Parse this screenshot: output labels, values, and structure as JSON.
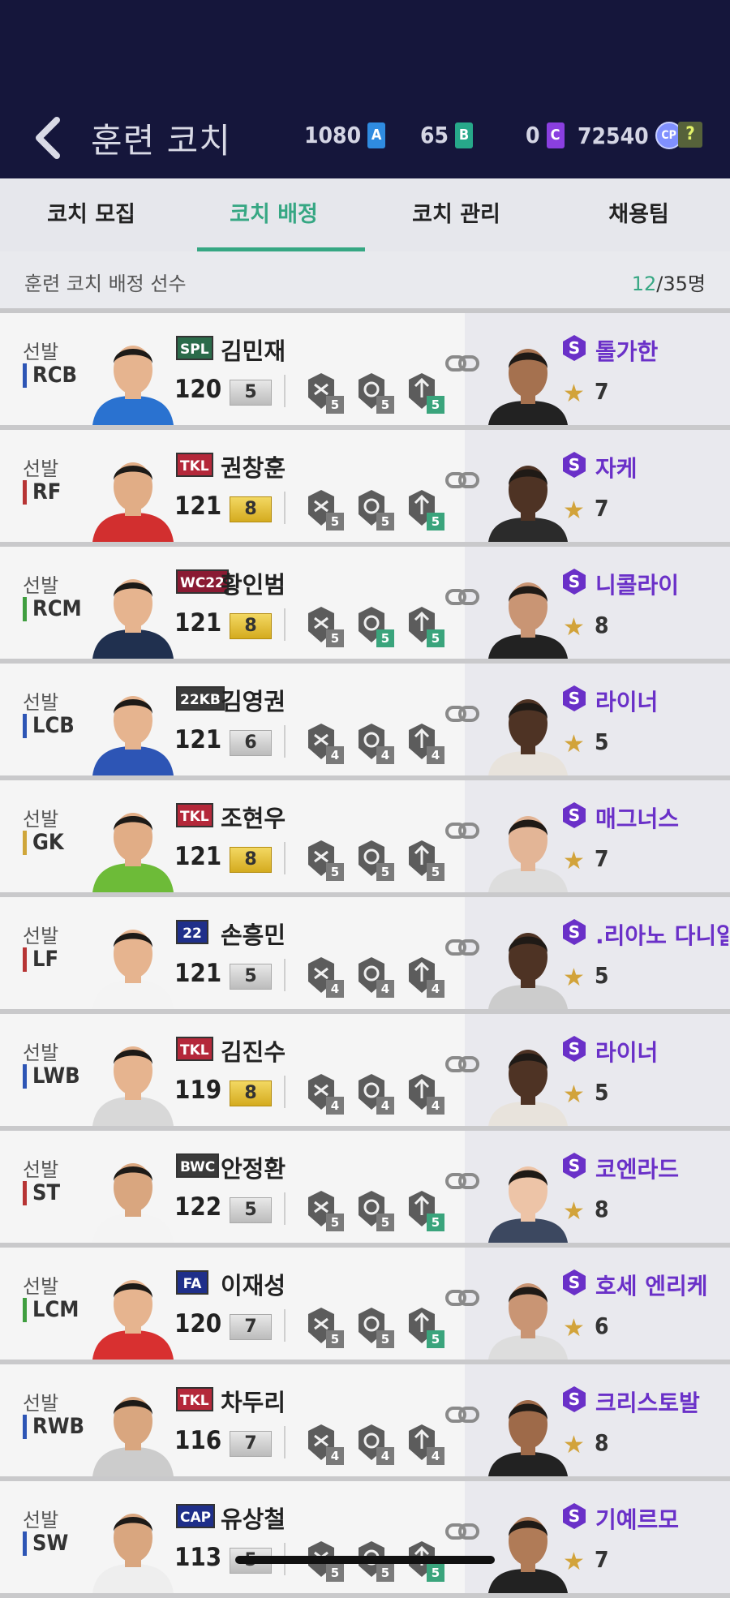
{
  "header": {
    "title": "훈련 코치",
    "currencies": [
      {
        "value": "1080",
        "badge": "A",
        "color": "#2f8be0"
      },
      {
        "value": "65",
        "badge": "B",
        "color": "#27a88a"
      },
      {
        "value": "0",
        "badge": "C",
        "color": "#8a3fe0"
      },
      {
        "value": "72540",
        "badge": "CP",
        "color": "#8090ff"
      }
    ],
    "help": "?"
  },
  "tabs": [
    "코치 모집",
    "코치 배정",
    "코치 관리",
    "채용팀"
  ],
  "active_tab": 1,
  "subheader": {
    "label": "훈련 코치 배정 선수",
    "assigned": "12",
    "total": "/35명"
  },
  "rows": [
    {
      "status": "선발",
      "pos": "RCB",
      "pos_color": "#2d55b5",
      "team": "SPL",
      "team_bg": "#2b6b4a",
      "name": "김민재",
      "ovr": "120",
      "grade": "5",
      "gold": false,
      "kit": "#2a72d0",
      "skin": "#e6b48f",
      "skills": [
        {
          "n": "5",
          "g": false
        },
        {
          "n": "5",
          "g": false
        },
        {
          "n": "5",
          "g": true
        }
      ],
      "coach": "톨가한",
      "stars": "7",
      "coach_skin": "#a5714f",
      "coach_suit": "#222"
    },
    {
      "status": "선발",
      "pos": "RF",
      "pos_color": "#b73434",
      "team": "TKL",
      "team_bg": "#b4283a",
      "name": "권창훈",
      "ovr": "121",
      "grade": "8",
      "gold": true,
      "kit": "#d22f2f",
      "skin": "#e1ad86",
      "skills": [
        {
          "n": "5",
          "g": false
        },
        {
          "n": "5",
          "g": false
        },
        {
          "n": "5",
          "g": true
        }
      ],
      "coach": "자케",
      "stars": "7",
      "coach_skin": "#4e3324",
      "coach_suit": "#2b2b2b"
    },
    {
      "status": "선발",
      "pos": "RCM",
      "pos_color": "#3f9e3f",
      "team": "WC22",
      "team_bg": "#8a1a33",
      "name": "황인범",
      "ovr": "121",
      "grade": "8",
      "gold": true,
      "kit": "#20304f",
      "skin": "#e6b48f",
      "skills": [
        {
          "n": "5",
          "g": false
        },
        {
          "n": "5",
          "g": true
        },
        {
          "n": "5",
          "g": true
        }
      ],
      "coach": "니콜라이",
      "stars": "8",
      "coach_skin": "#c99574",
      "coach_suit": "#222"
    },
    {
      "status": "선발",
      "pos": "LCB",
      "pos_color": "#2d55b5",
      "team": "22KB",
      "team_bg": "#3a3a3a",
      "name": "김영권",
      "ovr": "121",
      "grade": "6",
      "gold": false,
      "kit": "#2d55b5",
      "skin": "#e6b48f",
      "skills": [
        {
          "n": "4",
          "g": false
        },
        {
          "n": "4",
          "g": false
        },
        {
          "n": "4",
          "g": false
        }
      ],
      "coach": "라이너",
      "stars": "5",
      "coach_skin": "#4e3324",
      "coach_suit": "#e8e3dc"
    },
    {
      "status": "선발",
      "pos": "GK",
      "pos_color": "#cfa63a",
      "team": "TKL",
      "team_bg": "#b4283a",
      "name": "조현우",
      "ovr": "121",
      "grade": "8",
      "gold": true,
      "kit": "#6dbb38",
      "skin": "#e1ad86",
      "skills": [
        {
          "n": "5",
          "g": false
        },
        {
          "n": "5",
          "g": false
        },
        {
          "n": "5",
          "g": false
        }
      ],
      "coach": "매그너스",
      "stars": "7",
      "coach_skin": "#e3b596",
      "coach_suit": "#ddd"
    },
    {
      "status": "선발",
      "pos": "LF",
      "pos_color": "#b73434",
      "team": "22",
      "team_bg": "#1f2f8a",
      "name": "손흥민",
      "ovr": "121",
      "grade": "5",
      "gold": false,
      "kit": "#f4f4f4",
      "skin": "#e6b48f",
      "skills": [
        {
          "n": "4",
          "g": false
        },
        {
          "n": "4",
          "g": false
        },
        {
          "n": "4",
          "g": false
        }
      ],
      "coach": ".리아노 다니얼",
      "stars": "5",
      "coach_skin": "#4e3324",
      "coach_suit": "#ccc"
    },
    {
      "status": "선발",
      "pos": "LWB",
      "pos_color": "#2d55b5",
      "team": "TKL",
      "team_bg": "#b4283a",
      "name": "김진수",
      "ovr": "119",
      "grade": "8",
      "gold": true,
      "kit": "#d8d8d8",
      "skin": "#e6b48f",
      "skills": [
        {
          "n": "4",
          "g": false
        },
        {
          "n": "4",
          "g": false
        },
        {
          "n": "4",
          "g": false
        }
      ],
      "coach": "라이너",
      "stars": "5",
      "coach_skin": "#4e3324",
      "coach_suit": "#e8e3dc"
    },
    {
      "status": "선발",
      "pos": "ST",
      "pos_color": "#b73434",
      "team": "BWC",
      "team_bg": "#3a3a3a",
      "name": "안정환",
      "ovr": "122",
      "grade": "5",
      "gold": false,
      "kit": "#f4f4f4",
      "skin": "#d9a67f",
      "skills": [
        {
          "n": "5",
          "g": false
        },
        {
          "n": "5",
          "g": false
        },
        {
          "n": "5",
          "g": true
        }
      ],
      "coach": "코엔라드",
      "stars": "8",
      "coach_skin": "#edc4a7",
      "coach_suit": "#3c4860"
    },
    {
      "status": "선발",
      "pos": "LCM",
      "pos_color": "#3f9e3f",
      "team": "FA",
      "team_bg": "#1f2f8a",
      "name": "이재성",
      "ovr": "120",
      "grade": "7",
      "gold": false,
      "kit": "#d83030",
      "skin": "#e6b48f",
      "skills": [
        {
          "n": "5",
          "g": false
        },
        {
          "n": "5",
          "g": false
        },
        {
          "n": "5",
          "g": true
        }
      ],
      "coach": "호세 엔리케",
      "stars": "6",
      "coach_skin": "#c99574",
      "coach_suit": "#ddd"
    },
    {
      "status": "선발",
      "pos": "RWB",
      "pos_color": "#2d55b5",
      "team": "TKL",
      "team_bg": "#b4283a",
      "name": "차두리",
      "ovr": "116",
      "grade": "7",
      "gold": false,
      "kit": "#ccc",
      "skin": "#d9a67f",
      "skills": [
        {
          "n": "4",
          "g": false
        },
        {
          "n": "4",
          "g": false
        },
        {
          "n": "4",
          "g": false
        }
      ],
      "coach": "크리스토발",
      "stars": "8",
      "coach_skin": "#9e6a49",
      "coach_suit": "#222"
    },
    {
      "status": "선발",
      "pos": "SW",
      "pos_color": "#2d55b5",
      "team": "CAP",
      "team_bg": "#1f2f8a",
      "name": "유상철",
      "ovr": "113",
      "grade": "5",
      "gold": false,
      "kit": "#eee",
      "skin": "#d9a67f",
      "skills": [
        {
          "n": "5",
          "g": false
        },
        {
          "n": "5",
          "g": false
        },
        {
          "n": "5",
          "g": true
        }
      ],
      "coach": "기예르모",
      "stars": "7",
      "coach_skin": "#b07b57",
      "coach_suit": "#222"
    }
  ]
}
